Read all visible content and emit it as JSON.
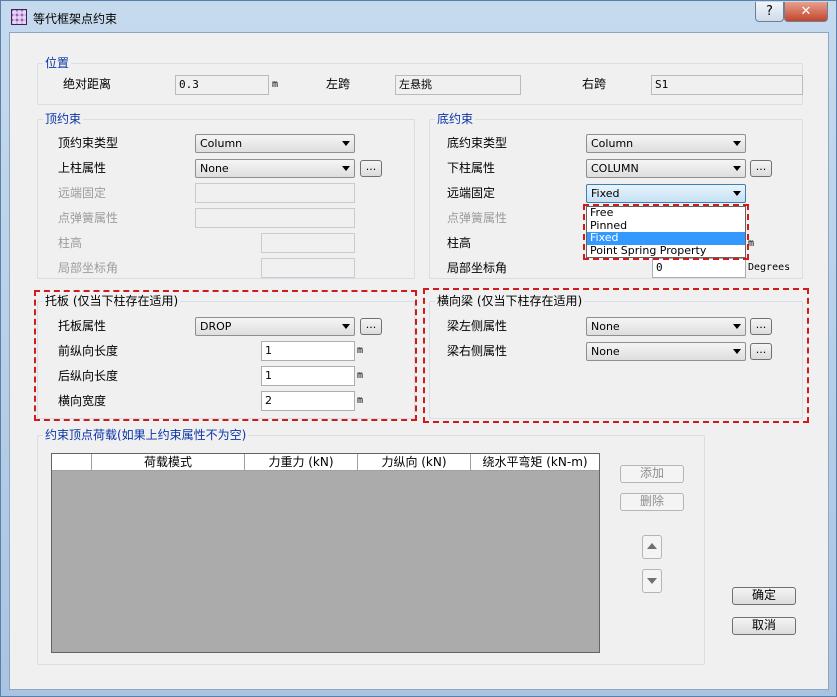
{
  "window": {
    "title": "等代框架点约束",
    "help_label": "?",
    "close_label": "✕"
  },
  "position": {
    "title": "位置",
    "abs_distance_label": "绝对距离",
    "abs_distance_value": "0.3",
    "abs_distance_unit": "m",
    "left_span_label": "左跨",
    "left_span_value": "左悬挑",
    "right_span_label": "右跨",
    "right_span_value": "S1"
  },
  "top": {
    "title": "顶约束",
    "type_label": "顶约束类型",
    "type_value": "Column",
    "upper_col_label": "上柱属性",
    "upper_col_value": "None",
    "far_fixed_label": "远端固定",
    "far_fixed_value": "",
    "spring_label": "点弹簧属性",
    "spring_value": "",
    "col_height_label": "柱高",
    "col_height_value": "",
    "local_axis_label": "局部坐标角",
    "local_axis_value": "",
    "dots_label": "..."
  },
  "bottom": {
    "title": "底约束",
    "type_label": "底约束类型",
    "type_value": "Column",
    "lower_col_label": "下柱属性",
    "lower_col_value": "COLUMN",
    "far_fixed_label": "远端固定",
    "far_fixed_value": "Fixed",
    "far_fixed_options": [
      "Free",
      "Pinned",
      "Fixed",
      "Point Spring Property"
    ],
    "spring_label": "点弹簧属性",
    "col_height_label": "柱高",
    "col_height_unit": "m",
    "local_axis_label": "局部坐标角",
    "local_axis_value": "0",
    "local_axis_unit": "Degrees",
    "dots_label": "..."
  },
  "drop": {
    "title": "托板 (仅当下柱存在适用)",
    "prop_label": "托板属性",
    "prop_value": "DROP",
    "front_label": "前纵向长度",
    "front_value": "1",
    "front_unit": "m",
    "back_label": "后纵向长度",
    "back_value": "1",
    "back_unit": "m",
    "width_label": "横向宽度",
    "width_value": "2",
    "width_unit": "m",
    "dots_label": "..."
  },
  "transverse": {
    "title": "横向梁 (仅当下柱存在适用)",
    "left_label": "梁左侧属性",
    "left_value": "None",
    "right_label": "梁右侧属性",
    "right_value": "None",
    "dots_label": "..."
  },
  "loads": {
    "title": "约束顶点荷载(如果上约束属性不为空)",
    "col_pattern": "荷载模式",
    "col_gravity": "力重力 (kN)",
    "col_longitudinal": "力纵向 (kN)",
    "col_moment": "绕水平弯矩 (kN-m)",
    "add_label": "添加",
    "delete_label": "删除"
  },
  "actions": {
    "ok_label": "确定",
    "cancel_label": "取消"
  }
}
